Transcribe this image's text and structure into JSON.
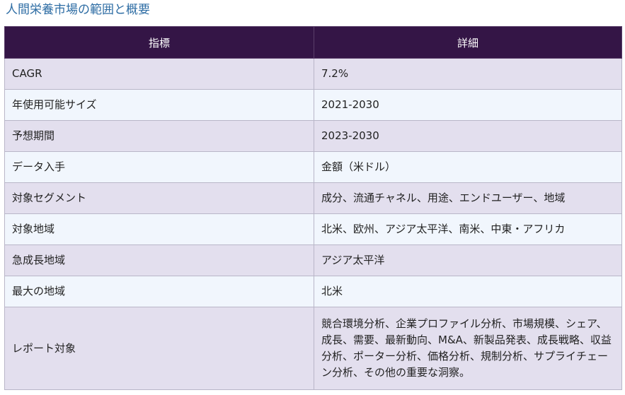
{
  "page": {
    "title": "人間栄養市場の範囲と概要"
  },
  "table": {
    "headers": [
      "指標",
      "詳細"
    ],
    "rows": [
      {
        "metric": "CAGR",
        "detail": "7.2%"
      },
      {
        "metric": "年使用可能サイズ",
        "detail": "2021-2030"
      },
      {
        "metric": "予想期間",
        "detail": "2023-2030"
      },
      {
        "metric": "データ入手",
        "detail": "金額（米ドル）"
      },
      {
        "metric": "対象セグメント",
        "detail": "成分、流通チャネル、用途、エンドユーザー、地域"
      },
      {
        "metric": "対象地域",
        "detail": "北米、欧州、アジア太平洋、南米、中東・アフリカ"
      },
      {
        "metric": "急成長地域",
        "detail": "アジア太平洋"
      },
      {
        "metric": "最大の地域",
        "detail": "北米"
      },
      {
        "metric": "レポート対象",
        "detail": "競合環境分析、企業プロファイル分析、市場規模、シェア、成長、需要、最新動向、M&A、新製品発表、成長戦略、収益分析、ポーター分析、価格分析、規制分析、サプライチェーン分析、その他の重要な洞察。"
      }
    ]
  },
  "colors": {
    "title": "#2e6da4",
    "header_bg": "#341546",
    "row_odd_bg": "#e3dfee",
    "row_even_bg": "#f1f6fd",
    "border": "#b9b6c8"
  }
}
